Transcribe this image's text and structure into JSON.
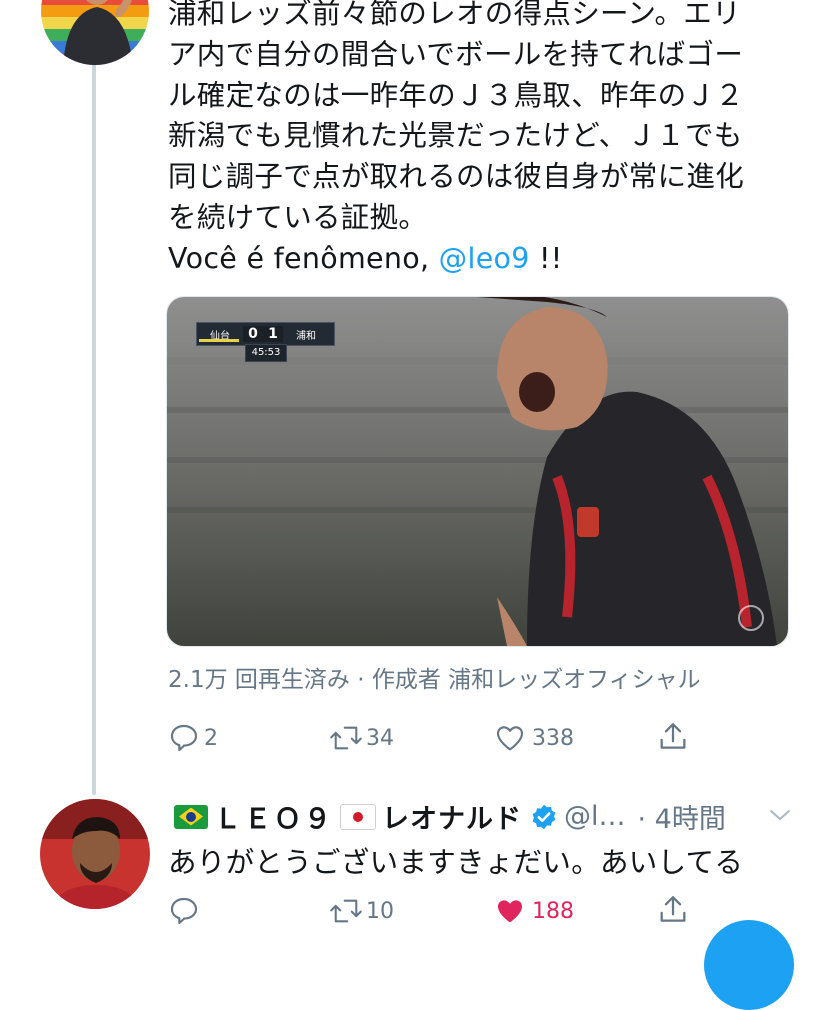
{
  "tweet": {
    "text_lines": [
      "浦和レッズ前々節のレオの得点シーン。エリ",
      "ア内で自分の間合いでボールを持てればゴー",
      "ル確定なのは一昨年のＪ３鳥取、昨年のＪ２",
      "新潟でも見慣れた光景だったけど、Ｊ１でも",
      "同じ調子で点が取れるのは彼自身が常に進化",
      "を続けている証拠。"
    ],
    "last_line_prefix": "Você é fenômeno, ",
    "mention": "@leo9",
    "last_line_suffix": " !!",
    "video": {
      "score": {
        "home": "仙台",
        "home_score": "0",
        "away_score": "1",
        "away": "浦和",
        "clock": "45:53"
      }
    },
    "views_text": "2.1万 回再生済み · 作成者 浦和レッズオフィシャル",
    "actions": {
      "replies": "2",
      "retweets": "34",
      "likes": "338"
    }
  },
  "reply": {
    "name_part1": "ＬＥＯ９",
    "name_part2": "レオナルド",
    "handle": "@l…",
    "time": "· 4時間",
    "text": "ありがとうございますきょだい。あいしてる",
    "actions": {
      "replies": "",
      "retweets": "10",
      "likes": "188"
    }
  },
  "colors": {
    "accent": "#1da1f2",
    "muted": "#657786",
    "like_active": "#e0245e",
    "verified": "#1da1f2"
  },
  "icons": [
    "reply-icon",
    "retweet-icon",
    "like-icon",
    "share-icon",
    "verified-badge-icon",
    "chevron-down-icon",
    "brazil-flag-icon",
    "japan-flag-icon"
  ]
}
